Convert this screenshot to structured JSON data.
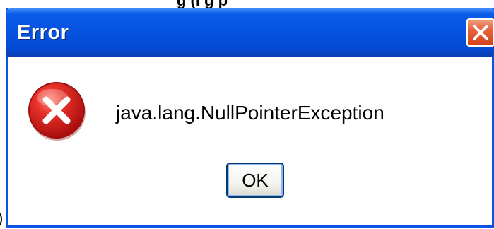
{
  "cropped_text": {
    "top": "g (l      g      p",
    "bottom_left": ")"
  },
  "dialog": {
    "title": "Error",
    "close_icon": "close-x-icon",
    "message_icon": "error-icon",
    "message": "java.lang.NullPointerException",
    "ok_label": "OK"
  },
  "colors": {
    "titlebar_blue": "#0553e0",
    "close_red": "#e8603a",
    "error_red": "#d81e1e"
  }
}
